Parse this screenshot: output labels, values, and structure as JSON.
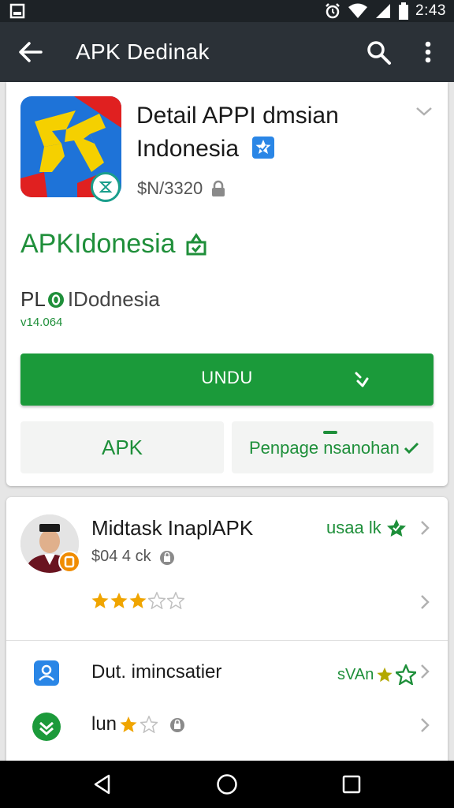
{
  "statusbar": {
    "time": "2:43"
  },
  "appbar": {
    "title": "APK Dedinak"
  },
  "app": {
    "title": "Detail APPI dmsian Indonesia",
    "meta": "$N/3320",
    "developer": "APKIdonesia",
    "publisher_prefix": "PL",
    "publisher": "IDodnesia",
    "version": "v14.064",
    "install_label": "UNDU",
    "apk_label": "APK",
    "permissions_label": "Penpage nsanohan"
  },
  "review": {
    "name": "Midtask InaplAPK",
    "sub": "$04 4 ck",
    "tag": "usaa lk",
    "rating": 3,
    "max_rating": 5
  },
  "rows": [
    {
      "label": "Dut. imincsatier",
      "tag": "sVAn",
      "icon": "person-icon"
    },
    {
      "label": "lun",
      "tag": "",
      "icon": "chevron-down-circle-icon",
      "rating": 1
    }
  ],
  "colors": {
    "accent": "#1b9a3a",
    "appbar": "#2b3137",
    "star": "#f0a500"
  }
}
